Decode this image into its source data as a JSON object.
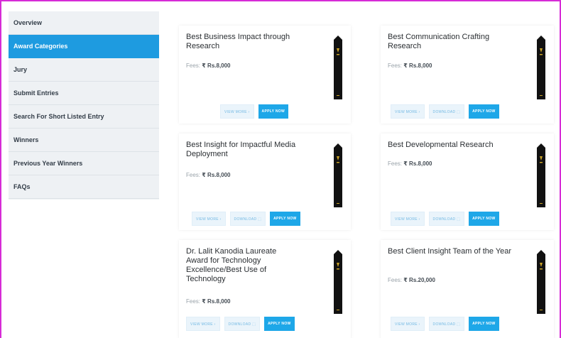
{
  "sidebar": {
    "items": [
      {
        "label": "Overview",
        "active": false
      },
      {
        "label": "Award Categories",
        "active": true
      },
      {
        "label": "Jury",
        "active": false
      },
      {
        "label": "Submit Entries",
        "active": false
      },
      {
        "label": "Search For Short Listed Entry",
        "active": false
      },
      {
        "label": "Winners",
        "active": false
      },
      {
        "label": "Previous Year Winners",
        "active": false
      },
      {
        "label": "FAQs",
        "active": false
      }
    ]
  },
  "buttons": {
    "view_more": "VIEW MORE ›",
    "download": "DOWNLOAD ⬚",
    "apply_now": "APPLY NOW"
  },
  "cards": [
    {
      "title": "Best Business Impact through Research",
      "fees_label": "Fees:",
      "fees_amount": "₹ Rs.8,000"
    },
    {
      "title": "Best Communication Crafting Research",
      "fees_label": "Fees:",
      "fees_amount": "₹ Rs.8,000"
    },
    {
      "title": "Best Insight for Impactful Media Deployment",
      "fees_label": "Fees:",
      "fees_amount": "₹ Rs.8,000"
    },
    {
      "title": "Best Developmental Research",
      "fees_label": "Fees:",
      "fees_amount": "₹ Rs.8,000"
    },
    {
      "title": "Dr. Lalit Kanodia Laureate Award for Technology Excellence/Best Use of Technology",
      "fees_label": "Fees:",
      "fees_amount": "₹ Rs.8,000"
    },
    {
      "title": "Best Client Insight Team of the Year",
      "fees_label": "Fees:",
      "fees_amount": "₹ Rs.20,000"
    }
  ],
  "colors": {
    "accent": "#1ea7e8",
    "sidebar_active": "#1e9be0",
    "frame_border": "#d62bd6",
    "trophy": "#111111",
    "trophy_emblem": "#c9a227"
  }
}
